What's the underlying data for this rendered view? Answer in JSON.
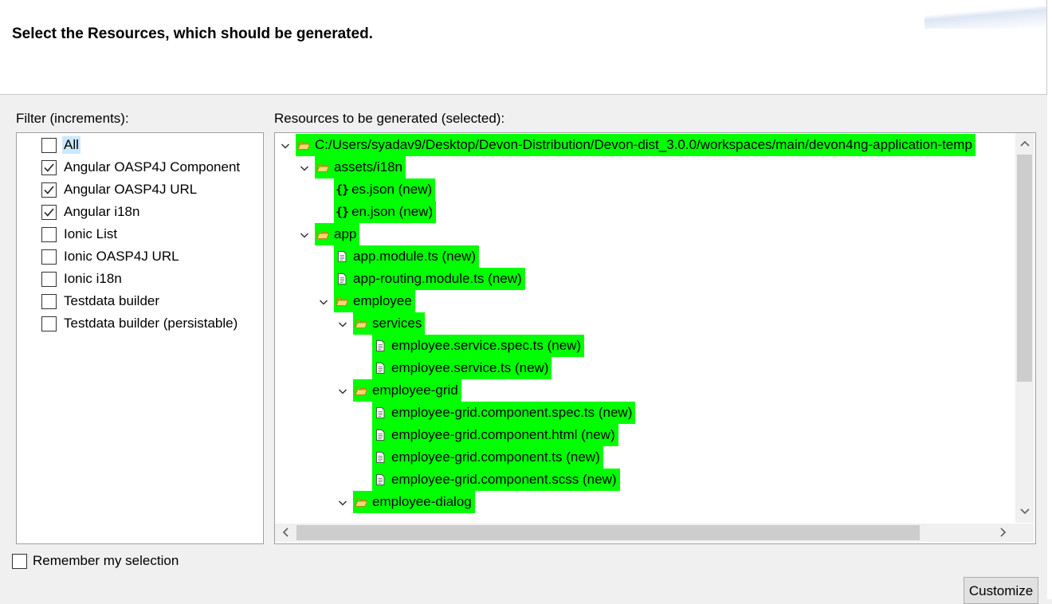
{
  "header": {
    "title": "Select the Resources, which should be generated."
  },
  "filter": {
    "label": "Filter (increments):",
    "items": [
      {
        "label": "All",
        "checked": false,
        "selected": true
      },
      {
        "label": "Angular OASP4J Component",
        "checked": true
      },
      {
        "label": "Angular OASP4J URL",
        "checked": true
      },
      {
        "label": "Angular i18n",
        "checked": true
      },
      {
        "label": "Ionic List",
        "checked": false
      },
      {
        "label": "Ionic OASP4J URL",
        "checked": false
      },
      {
        "label": "Ionic i18n",
        "checked": false
      },
      {
        "label": "Testdata builder",
        "checked": false
      },
      {
        "label": "Testdata builder (persistable)",
        "checked": false
      }
    ]
  },
  "resources": {
    "label": "Resources to be generated (selected):",
    "highlight_color": "#00ff00",
    "tree": [
      {
        "label": "C:/Users/syadav9/Desktop/Devon-Distribution/Devon-dist_3.0.0/workspaces/main/devon4ng-application-temp",
        "icon": "folder-open-icon",
        "level": 0,
        "expanded": true
      },
      {
        "label": "assets/i18n",
        "icon": "folder-open-icon",
        "level": 1,
        "expanded": true
      },
      {
        "label": "es.json (new)",
        "icon": "json-file-icon",
        "level": 2
      },
      {
        "label": "en.json (new)",
        "icon": "json-file-icon",
        "level": 2
      },
      {
        "label": "app",
        "icon": "folder-open-icon",
        "level": 1,
        "expanded": true
      },
      {
        "label": "app.module.ts (new)",
        "icon": "file-icon",
        "level": 2
      },
      {
        "label": "app-routing.module.ts (new)",
        "icon": "file-icon",
        "level": 2
      },
      {
        "label": "employee",
        "icon": "folder-open-icon",
        "level": 2,
        "expanded": true
      },
      {
        "label": "services",
        "icon": "folder-open-icon",
        "level": 3,
        "expanded": true
      },
      {
        "label": "employee.service.spec.ts (new)",
        "icon": "file-icon",
        "level": 4
      },
      {
        "label": "employee.service.ts (new)",
        "icon": "file-icon",
        "level": 4
      },
      {
        "label": "employee-grid",
        "icon": "folder-open-icon",
        "level": 3,
        "expanded": true
      },
      {
        "label": "employee-grid.component.spec.ts (new)",
        "icon": "file-icon",
        "level": 4
      },
      {
        "label": "employee-grid.component.html (new)",
        "icon": "file-icon",
        "level": 4
      },
      {
        "label": "employee-grid.component.ts (new)",
        "icon": "file-icon",
        "level": 4
      },
      {
        "label": "employee-grid.component.scss (new)",
        "icon": "file-icon",
        "level": 4
      },
      {
        "label": "employee-dialog",
        "icon": "folder-open-icon",
        "level": 3,
        "expanded": true
      }
    ]
  },
  "remember": {
    "label": "Remember my selection",
    "checked": false
  },
  "buttons": {
    "customize": "Customize"
  }
}
